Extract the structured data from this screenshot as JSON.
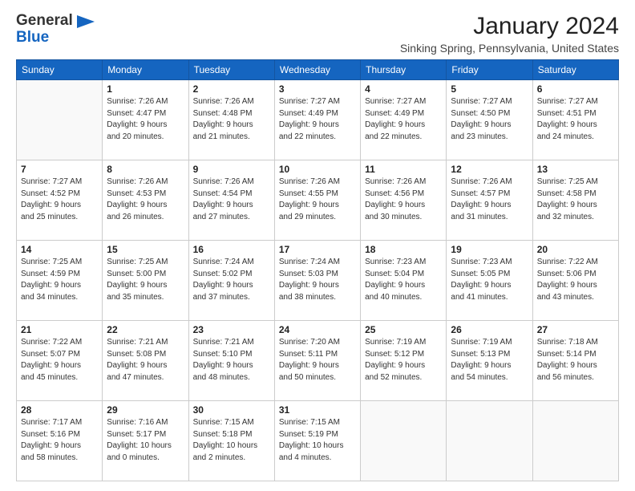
{
  "header": {
    "logo_line1": "General",
    "logo_line2": "Blue",
    "month_title": "January 2024",
    "location": "Sinking Spring, Pennsylvania, United States"
  },
  "days_of_week": [
    "Sunday",
    "Monday",
    "Tuesday",
    "Wednesday",
    "Thursday",
    "Friday",
    "Saturday"
  ],
  "weeks": [
    [
      {
        "day": "",
        "info": ""
      },
      {
        "day": "1",
        "info": "Sunrise: 7:26 AM\nSunset: 4:47 PM\nDaylight: 9 hours\nand 20 minutes."
      },
      {
        "day": "2",
        "info": "Sunrise: 7:26 AM\nSunset: 4:48 PM\nDaylight: 9 hours\nand 21 minutes."
      },
      {
        "day": "3",
        "info": "Sunrise: 7:27 AM\nSunset: 4:49 PM\nDaylight: 9 hours\nand 22 minutes."
      },
      {
        "day": "4",
        "info": "Sunrise: 7:27 AM\nSunset: 4:49 PM\nDaylight: 9 hours\nand 22 minutes."
      },
      {
        "day": "5",
        "info": "Sunrise: 7:27 AM\nSunset: 4:50 PM\nDaylight: 9 hours\nand 23 minutes."
      },
      {
        "day": "6",
        "info": "Sunrise: 7:27 AM\nSunset: 4:51 PM\nDaylight: 9 hours\nand 24 minutes."
      }
    ],
    [
      {
        "day": "7",
        "info": "Sunrise: 7:27 AM\nSunset: 4:52 PM\nDaylight: 9 hours\nand 25 minutes."
      },
      {
        "day": "8",
        "info": "Sunrise: 7:26 AM\nSunset: 4:53 PM\nDaylight: 9 hours\nand 26 minutes."
      },
      {
        "day": "9",
        "info": "Sunrise: 7:26 AM\nSunset: 4:54 PM\nDaylight: 9 hours\nand 27 minutes."
      },
      {
        "day": "10",
        "info": "Sunrise: 7:26 AM\nSunset: 4:55 PM\nDaylight: 9 hours\nand 29 minutes."
      },
      {
        "day": "11",
        "info": "Sunrise: 7:26 AM\nSunset: 4:56 PM\nDaylight: 9 hours\nand 30 minutes."
      },
      {
        "day": "12",
        "info": "Sunrise: 7:26 AM\nSunset: 4:57 PM\nDaylight: 9 hours\nand 31 minutes."
      },
      {
        "day": "13",
        "info": "Sunrise: 7:25 AM\nSunset: 4:58 PM\nDaylight: 9 hours\nand 32 minutes."
      }
    ],
    [
      {
        "day": "14",
        "info": "Sunrise: 7:25 AM\nSunset: 4:59 PM\nDaylight: 9 hours\nand 34 minutes."
      },
      {
        "day": "15",
        "info": "Sunrise: 7:25 AM\nSunset: 5:00 PM\nDaylight: 9 hours\nand 35 minutes."
      },
      {
        "day": "16",
        "info": "Sunrise: 7:24 AM\nSunset: 5:02 PM\nDaylight: 9 hours\nand 37 minutes."
      },
      {
        "day": "17",
        "info": "Sunrise: 7:24 AM\nSunset: 5:03 PM\nDaylight: 9 hours\nand 38 minutes."
      },
      {
        "day": "18",
        "info": "Sunrise: 7:23 AM\nSunset: 5:04 PM\nDaylight: 9 hours\nand 40 minutes."
      },
      {
        "day": "19",
        "info": "Sunrise: 7:23 AM\nSunset: 5:05 PM\nDaylight: 9 hours\nand 41 minutes."
      },
      {
        "day": "20",
        "info": "Sunrise: 7:22 AM\nSunset: 5:06 PM\nDaylight: 9 hours\nand 43 minutes."
      }
    ],
    [
      {
        "day": "21",
        "info": "Sunrise: 7:22 AM\nSunset: 5:07 PM\nDaylight: 9 hours\nand 45 minutes."
      },
      {
        "day": "22",
        "info": "Sunrise: 7:21 AM\nSunset: 5:08 PM\nDaylight: 9 hours\nand 47 minutes."
      },
      {
        "day": "23",
        "info": "Sunrise: 7:21 AM\nSunset: 5:10 PM\nDaylight: 9 hours\nand 48 minutes."
      },
      {
        "day": "24",
        "info": "Sunrise: 7:20 AM\nSunset: 5:11 PM\nDaylight: 9 hours\nand 50 minutes."
      },
      {
        "day": "25",
        "info": "Sunrise: 7:19 AM\nSunset: 5:12 PM\nDaylight: 9 hours\nand 52 minutes."
      },
      {
        "day": "26",
        "info": "Sunrise: 7:19 AM\nSunset: 5:13 PM\nDaylight: 9 hours\nand 54 minutes."
      },
      {
        "day": "27",
        "info": "Sunrise: 7:18 AM\nSunset: 5:14 PM\nDaylight: 9 hours\nand 56 minutes."
      }
    ],
    [
      {
        "day": "28",
        "info": "Sunrise: 7:17 AM\nSunset: 5:16 PM\nDaylight: 9 hours\nand 58 minutes."
      },
      {
        "day": "29",
        "info": "Sunrise: 7:16 AM\nSunset: 5:17 PM\nDaylight: 10 hours\nand 0 minutes."
      },
      {
        "day": "30",
        "info": "Sunrise: 7:15 AM\nSunset: 5:18 PM\nDaylight: 10 hours\nand 2 minutes."
      },
      {
        "day": "31",
        "info": "Sunrise: 7:15 AM\nSunset: 5:19 PM\nDaylight: 10 hours\nand 4 minutes."
      },
      {
        "day": "",
        "info": ""
      },
      {
        "day": "",
        "info": ""
      },
      {
        "day": "",
        "info": ""
      }
    ]
  ]
}
